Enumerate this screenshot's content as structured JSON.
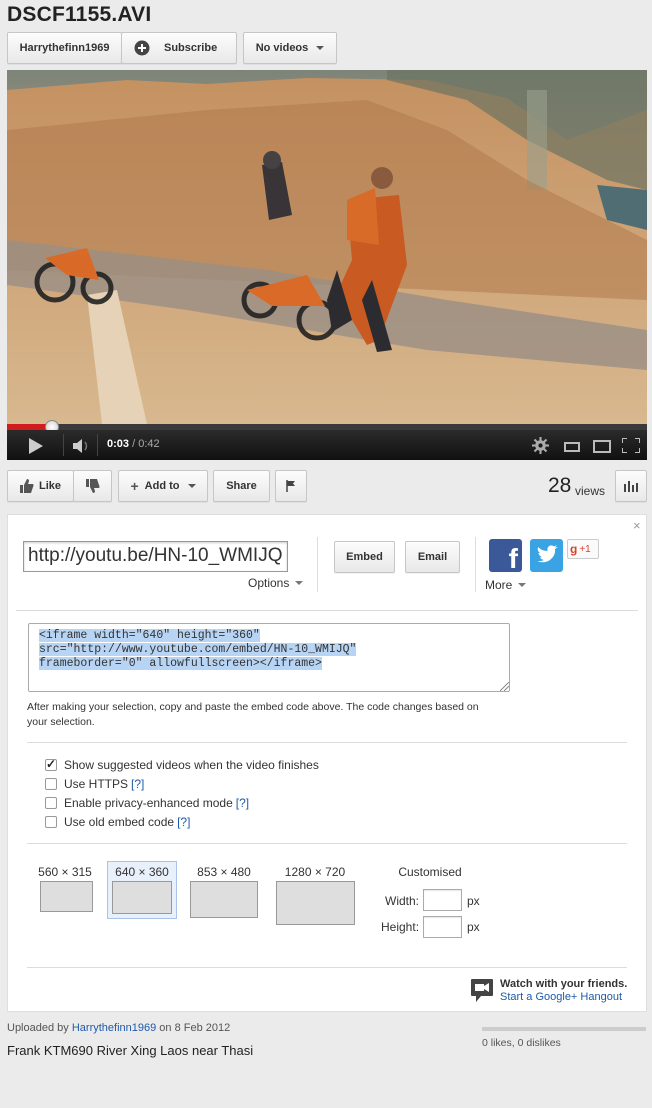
{
  "title": "DSCF1155.AVI",
  "channel": {
    "name": "Harrythefinn1969",
    "subscribe_label": "Subscribe",
    "videos_label": "No videos"
  },
  "player": {
    "current_time": "0:03",
    "separator": "/",
    "duration": "0:42",
    "progress_fraction": 0.07
  },
  "actions": {
    "like_label": "Like",
    "add_to_label": "Add to",
    "share_label": "Share",
    "views_count": "28",
    "views_label": "views"
  },
  "share": {
    "url": "http://youtu.be/HN-10_WMIJQ",
    "options_label": "Options",
    "embed_label": "Embed",
    "email_label": "Email",
    "more_label": "More",
    "gplus_label": "+1",
    "embed_code_line1": "<iframe width=\"640\" height=\"360\"",
    "embed_code_line2": "src=\"http://www.youtube.com/embed/HN-10_WMIJQ\"",
    "embed_code_line3": "frameborder=\"0\" allowfullscreen></iframe>",
    "note": "After making your selection, copy and paste the embed code above. The code changes based on your selection.",
    "options": [
      {
        "label": "Show suggested videos when the video finishes",
        "checked": true,
        "help": ""
      },
      {
        "label": "Use HTTPS",
        "checked": false,
        "help": "[?]"
      },
      {
        "label": "Enable privacy-enhanced mode",
        "checked": false,
        "help": "[?]"
      },
      {
        "label": "Use old embed code",
        "checked": false,
        "help": "[?]"
      }
    ],
    "sizes": [
      "560 × 315",
      "640 × 360",
      "853 × 480",
      "1280 × 720"
    ],
    "selected_size": "640 × 360",
    "customised_label": "Customised",
    "width_label": "Width:",
    "height_label": "Height:",
    "px_label": "px",
    "hangout_title": "Watch with your friends.",
    "hangout_link": "Start a Google+ Hangout"
  },
  "upload": {
    "prefix": "Uploaded by",
    "user": "Harrythefinn1969",
    "on": "on",
    "date": "8 Feb 2012",
    "description": "Frank KTM690 River Xing Laos near Thasi",
    "likes_text": "0 likes, 0 dislikes"
  },
  "colors": {
    "link": "#1f5aa8",
    "progress": "#d01c1c",
    "selection": "#b7d4f4",
    "facebook": "#3b5998",
    "twitter": "#3aa3e3",
    "gplus": "#d8432e"
  }
}
